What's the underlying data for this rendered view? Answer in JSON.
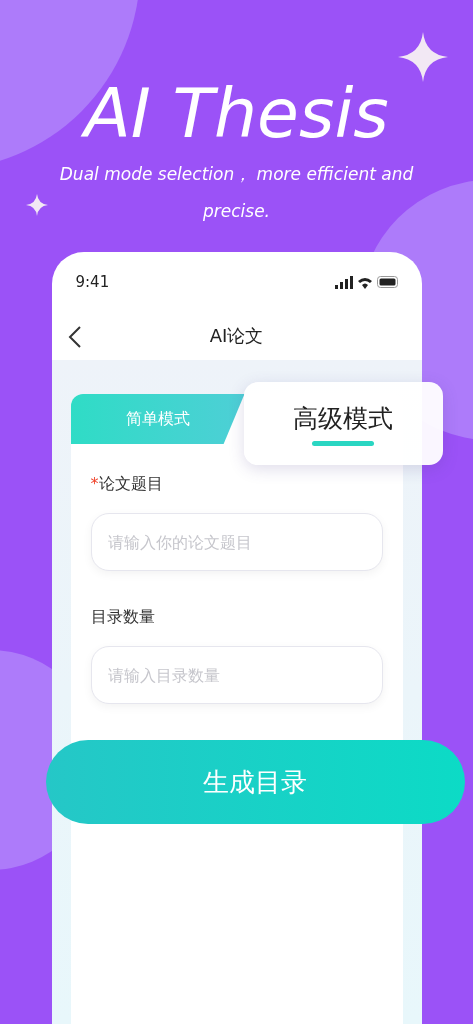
{
  "headline": {
    "title": "AI Thesis",
    "subtitle": "Dual mode selection，  more efficient and precise."
  },
  "phone": {
    "status_time": "9:41",
    "nav_title": "AI论文",
    "tabs": [
      {
        "label": "简单模式",
        "selected": false
      },
      {
        "label": "高级模式",
        "selected": true
      }
    ],
    "fields": [
      {
        "required_mark": "*",
        "label": "论文题目",
        "placeholder": "请输入你的论文题目"
      },
      {
        "label": "目录数量",
        "placeholder": "请输入目录数量"
      }
    ],
    "button": "生成目录"
  }
}
